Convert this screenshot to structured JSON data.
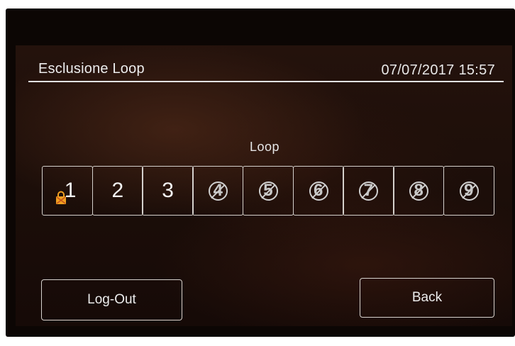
{
  "header": {
    "title": "Esclusione Loop",
    "datetime": "07/07/2017 15:57"
  },
  "loop_section": {
    "label": "Loop",
    "loops": [
      {
        "number": "1",
        "state": "selected",
        "icon": "lock-icon"
      },
      {
        "number": "2",
        "state": "active"
      },
      {
        "number": "3",
        "state": "active"
      },
      {
        "number": "4",
        "state": "excluded",
        "icon": "no-entry-icon"
      },
      {
        "number": "5",
        "state": "excluded",
        "icon": "no-entry-icon"
      },
      {
        "number": "6",
        "state": "excluded",
        "icon": "no-entry-icon"
      },
      {
        "number": "7",
        "state": "excluded",
        "icon": "no-entry-icon"
      },
      {
        "number": "8",
        "state": "excluded",
        "icon": "no-entry-icon"
      },
      {
        "number": "9",
        "state": "excluded",
        "icon": "no-entry-icon"
      }
    ]
  },
  "buttons": {
    "logout_label": "Log-Out",
    "back_label": "Back"
  },
  "colors": {
    "screen_background": "#1c0e09",
    "text": "#ececec",
    "border": "#d4d0cc",
    "lock_icon": "#f0a020"
  }
}
